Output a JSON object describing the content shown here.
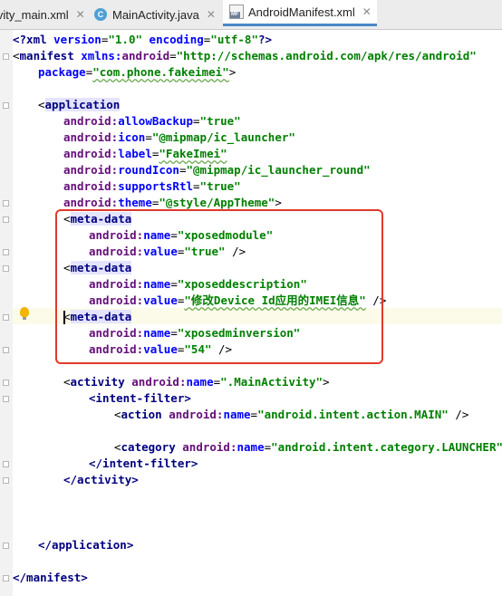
{
  "tabs": [
    {
      "label": "ivity_main.xml",
      "icon": "xml-file-icon",
      "active": false
    },
    {
      "label": "MainActivity.java",
      "icon": "java-class-icon",
      "icon_glyph": "C",
      "active": false
    },
    {
      "label": "AndroidManifest.xml",
      "icon": "manifest-file-icon",
      "icon_glyph": "MF",
      "active": true
    }
  ],
  "close_glyph": "✕",
  "code": {
    "xml_decl": {
      "open": "<?xml ",
      "version_attr": "version",
      "version_val": "\"1.0\"",
      "encoding_attr": "encoding",
      "encoding_val": "\"utf-8\"",
      "close": "?>"
    },
    "manifest_open": {
      "lt": "<",
      "tag": "manifest",
      "ns": "xmlns:",
      "ns_name": "android",
      "eq": "=",
      "value": "\"http://schemas.android.com/apk/res/android\""
    },
    "package_line": {
      "attr": "package",
      "eq": "=",
      "value": "\"com.phone.fakeimei\"",
      "close": ">"
    },
    "application_open": {
      "lt": "<",
      "tag": "application"
    },
    "application_attrs": [
      {
        "ns": "android:",
        "name": "allowBackup",
        "value": "\"true\""
      },
      {
        "ns": "android:",
        "name": "icon",
        "value": "\"@mipmap/ic_launcher\""
      },
      {
        "ns": "android:",
        "name": "label",
        "value": "\"FakeImei\""
      },
      {
        "ns": "android:",
        "name": "roundIcon",
        "value": "\"@mipmap/ic_launcher_round\""
      },
      {
        "ns": "android:",
        "name": "supportsRtl",
        "value": "\"true\""
      },
      {
        "ns": "android:",
        "name": "theme",
        "value": "\"@style/AppTheme\"",
        "close": ">"
      }
    ],
    "meta_blocks": [
      {
        "lt": "<",
        "tag": "meta-data",
        "name_ns": "android:",
        "name_attr": "name",
        "name_val": "\"xposedmodule\"",
        "value_ns": "android:",
        "value_attr": "value",
        "value_val": "\"true\"",
        "close": " />"
      },
      {
        "lt": "<",
        "tag": "meta-data",
        "name_ns": "android:",
        "name_attr": "name",
        "name_val": "\"xposeddescription\"",
        "value_ns": "android:",
        "value_attr": "value",
        "value_val": "\"修改Device Id应用的IMEI信息\"",
        "close": " />"
      },
      {
        "lt": "<",
        "tag": "meta-data",
        "name_ns": "android:",
        "name_attr": "name",
        "name_val": "\"xposedminversion\"",
        "value_ns": "android:",
        "value_attr": "value",
        "value_val": "\"54\"",
        "close": " />"
      }
    ],
    "activity_open": {
      "lt": "<",
      "tag": "activity",
      "ns": "android:",
      "attr": "name",
      "value": "\".MainActivity\"",
      "close": ">"
    },
    "intent_filter_open": "<intent-filter>",
    "action_line": {
      "lt": "<",
      "tag": "action",
      "ns": "android:",
      "attr": "name",
      "value": "\"android.intent.action.MAIN\"",
      "close": " />"
    },
    "category_line": {
      "lt": "<",
      "tag": "category",
      "ns": "android:",
      "attr": "name",
      "value": "\"android.intent.category.LAUNCHER\"",
      "close": " />"
    },
    "intent_filter_close": "</intent-filter>",
    "activity_close": "</activity>",
    "application_close": "</application>",
    "manifest_close": "</manifest>",
    "eq": "="
  },
  "colors": {
    "tag": "#000080",
    "namespace": "#660e7a",
    "attribute": "#0000ff",
    "string": "#008000",
    "annotation_box": "#e03a2b",
    "active_tab_underline": "#4a88c7"
  }
}
